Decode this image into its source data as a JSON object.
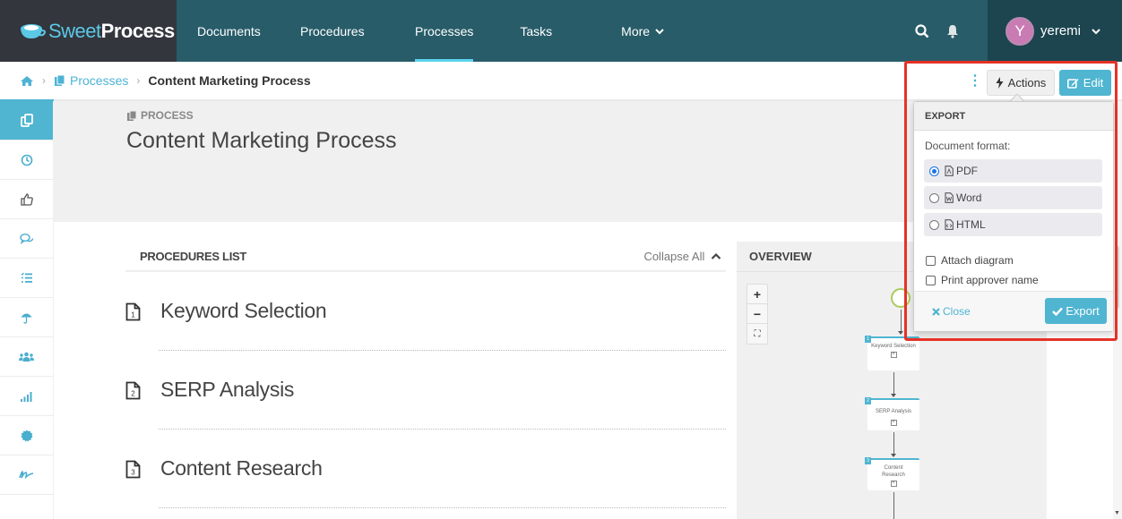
{
  "brand": {
    "name_part1": "Sweet",
    "name_part2": "Process"
  },
  "nav": {
    "items": [
      {
        "label": "Documents",
        "active": false
      },
      {
        "label": "Procedures",
        "active": false
      },
      {
        "label": "Processes",
        "active": true
      },
      {
        "label": "Tasks",
        "active": false
      },
      {
        "label": "More",
        "active": false
      }
    ],
    "search_icon": "search-icon",
    "bell_icon": "bell-icon",
    "user": {
      "initial": "Y",
      "name": "yeremi",
      "avatar_color": "#c97bb4"
    }
  },
  "breadcrumb": {
    "home_icon": "home-icon",
    "items": [
      "Processes",
      "Content Marketing Process"
    ]
  },
  "sidebar": {
    "items": [
      {
        "icon": "copy-icon",
        "active": true
      },
      {
        "icon": "clock-icon"
      },
      {
        "icon": "thumbs-up-icon"
      },
      {
        "icon": "comments-icon"
      },
      {
        "icon": "checklist-icon"
      },
      {
        "icon": "umbrella-icon"
      },
      {
        "icon": "users-icon"
      },
      {
        "icon": "signal-icon"
      },
      {
        "icon": "badge-icon"
      },
      {
        "icon": "signature-icon"
      }
    ]
  },
  "header": {
    "kicker": "PROCESS",
    "title": "Content Marketing Process"
  },
  "procedures": {
    "title": "PROCEDURES LIST",
    "collapse_label": "Collapse All",
    "items": [
      {
        "number": "1",
        "name": "Keyword Selection"
      },
      {
        "number": "2",
        "name": "SERP Analysis"
      },
      {
        "number": "3",
        "name": "Content Research"
      }
    ]
  },
  "overview": {
    "title": "OVERVIEW",
    "zoom_in": "+",
    "zoom_out": "−",
    "fit": "⛶",
    "nodes": [
      {
        "number": "1",
        "label": "Keyword Selection"
      },
      {
        "number": "2",
        "label": "SERP Analysis"
      },
      {
        "number": "3",
        "label": "Content Research"
      }
    ]
  },
  "actions": {
    "actions_label": "Actions",
    "edit_label": "Edit"
  },
  "export": {
    "title": "EXPORT",
    "format_label": "Document format:",
    "formats": [
      {
        "label": "PDF",
        "selected": true
      },
      {
        "label": "Word",
        "selected": false
      },
      {
        "label": "HTML",
        "selected": false
      }
    ],
    "options": [
      {
        "label": "Attach diagram",
        "checked": false
      },
      {
        "label": "Print approver name",
        "checked": false
      }
    ],
    "close_label": "Close",
    "export_label": "Export"
  },
  "colors": {
    "nav_bg": "#285c69",
    "brand_bg": "#33363d",
    "accent": "#4fb5d1",
    "highlight": "#e53226"
  }
}
